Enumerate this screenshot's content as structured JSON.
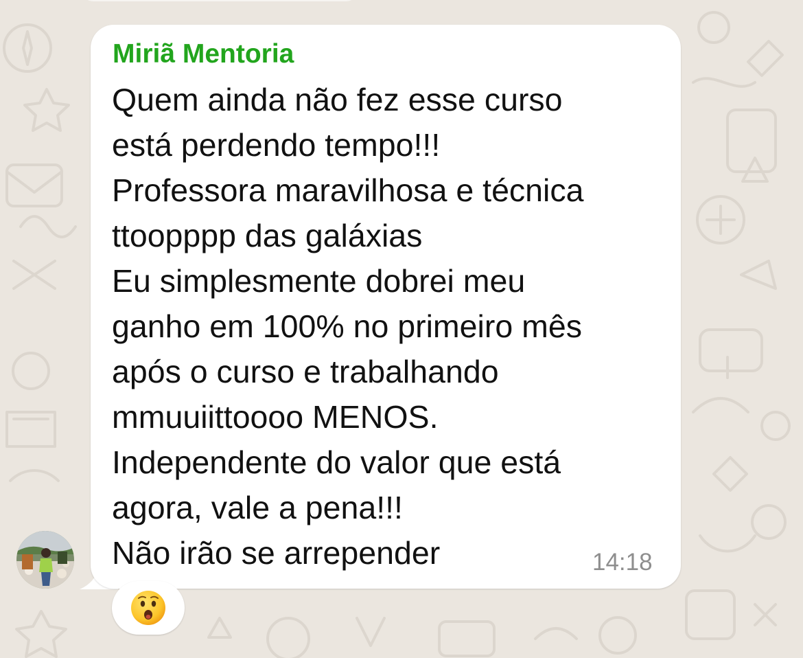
{
  "chat": {
    "message": {
      "sender": "Miriã Mentoria",
      "sender_color": "#22a51d",
      "lines": [
        "Quem ainda não fez esse curso",
        "está perdendo tempo!!!",
        "Professora maravilhosa e técnica",
        "ttoopppp das galáxias",
        "Eu simplesmente dobrei meu",
        "ganho em 100% no primeiro mês",
        "após o curso e trabalhando",
        "mmuuiittoooo MENOS.",
        "Independente do valor que está",
        "agora, vale a pena!!!",
        "Não irão se arrepender"
      ],
      "time": "14:18",
      "reaction": {
        "icon": "hushed-face-emoji"
      }
    },
    "avatar": {
      "icon": "contact-avatar-photo"
    },
    "theme": {
      "wallpaper_color": "#ebe6df",
      "bubble_color": "#ffffff",
      "text_color": "#111111",
      "time_color": "#8e8e8e"
    }
  }
}
